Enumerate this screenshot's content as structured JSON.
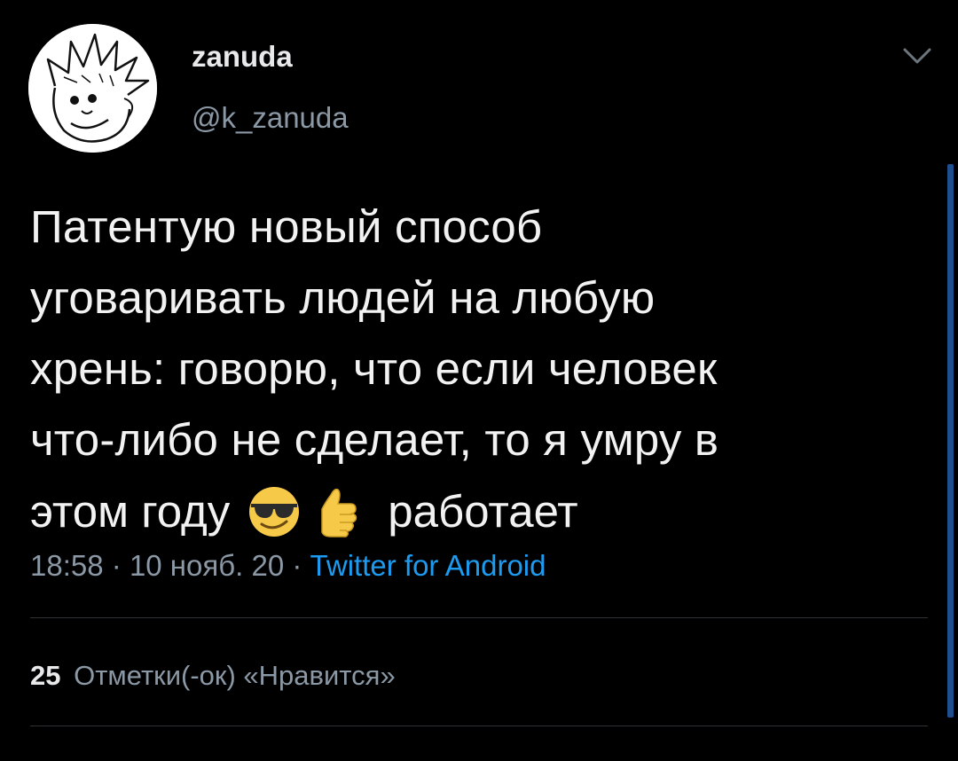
{
  "user": {
    "display_name": "zanuda",
    "handle": "@k_zanuda",
    "avatar_icon": "cartoon-avatar-icon"
  },
  "menu": {
    "icon": "chevron-down-icon"
  },
  "tweet": {
    "text_lines": "Патентую новый способ\nуговаривать людей на любую\nхрень: говорю, что если человек\nчто-либо не сделает, то я умру в",
    "last_line_before": "этом году",
    "emojis": [
      "sunglasses-face-icon",
      "thumbs-up-icon"
    ],
    "last_line_after": "работает"
  },
  "meta": {
    "time": "18:58",
    "separator": "·",
    "date": "10 нояб. 20",
    "source": "Twitter for Android"
  },
  "stats": {
    "likes_count": "25",
    "likes_label": "Отметки(-ок) «Нравится»"
  },
  "colors": {
    "background": "#000000",
    "primary_text": "#e7e9ea",
    "secondary_text": "#8b98a5",
    "link": "#1d9bf0",
    "divider": "#2f3336",
    "scrollbar": "#1f4f8f"
  }
}
